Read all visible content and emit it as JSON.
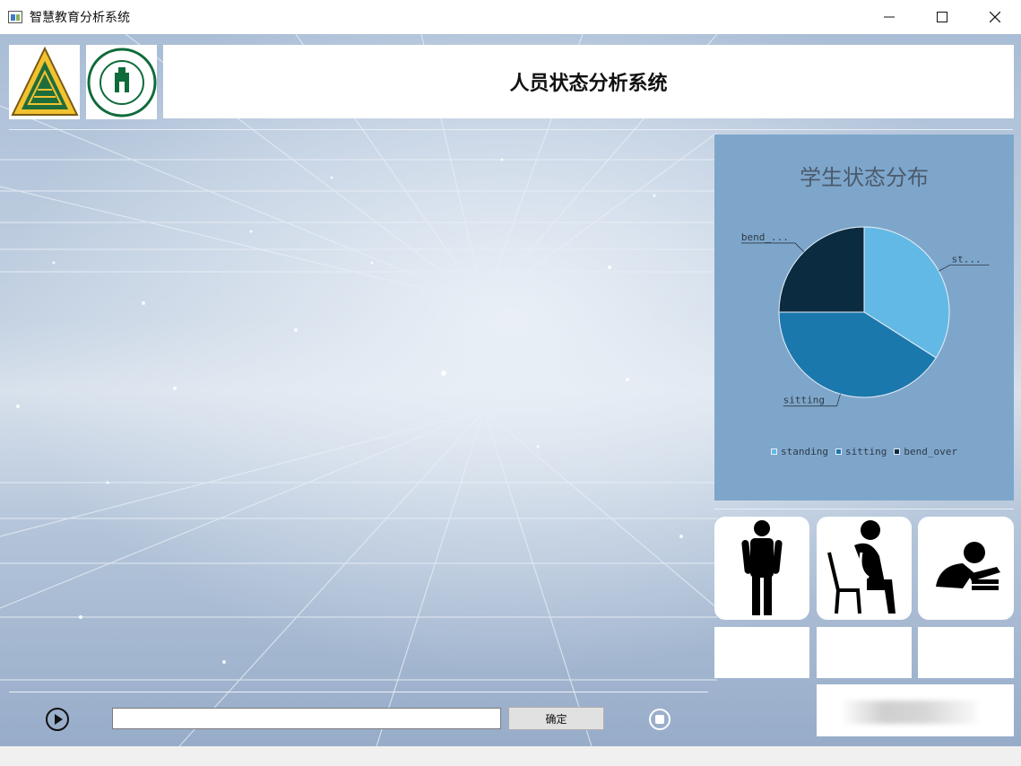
{
  "window": {
    "title": "智慧教育分析系统",
    "minimize": "—",
    "maximize": "☐",
    "close": "✕"
  },
  "header": {
    "title": "人员状态分析系统",
    "logos": [
      "school-logo",
      "sun-yat-sen-university-logo"
    ]
  },
  "chart_data": {
    "type": "pie",
    "title": "学生状态分布",
    "categories": [
      "standing",
      "sitting",
      "bend_over"
    ],
    "values": [
      34,
      41,
      25
    ],
    "colors": [
      "#63b9e6",
      "#1b78ad",
      "#0b2b40"
    ],
    "slice_labels": [
      "st...",
      "sitting",
      "bend_..."
    ],
    "legend_position": "bottom"
  },
  "status_cards": [
    {
      "icon": "standing-person-icon",
      "count": ""
    },
    {
      "icon": "sitting-person-icon",
      "count": ""
    },
    {
      "icon": "bend-over-reading-icon",
      "count": ""
    }
  ],
  "controls": {
    "play_icon": "play-icon",
    "path_value": "",
    "confirm_label": "确定",
    "stop_icon": "stop-icon"
  }
}
